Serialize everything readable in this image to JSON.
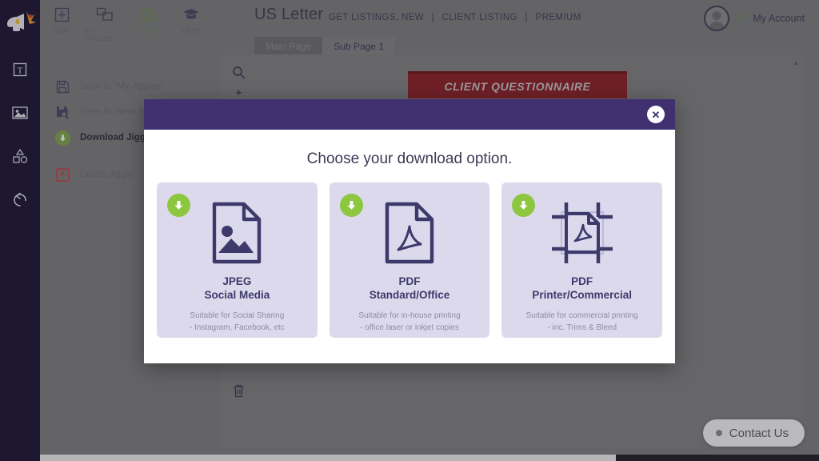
{
  "rail": {
    "logo_icon": "megaphone-burst-logo",
    "items": [
      {
        "icon": "text-tool-icon",
        "name": "text-tool"
      },
      {
        "icon": "image-tool-icon",
        "name": "image-tool"
      },
      {
        "icon": "shapes-tool-icon",
        "name": "shapes-tool"
      },
      {
        "icon": "undo-tool-icon",
        "name": "undo-tool"
      }
    ]
  },
  "toolbar": {
    "items": [
      {
        "label": "NEW",
        "icon": "plus-square-icon"
      },
      {
        "label": "MY JIGGLES",
        "icon": "frames-icon"
      },
      {
        "label": "SAVE",
        "icon": "floppy-disk-icon"
      },
      {
        "label": "HELP",
        "icon": "graduation-cap-icon"
      }
    ]
  },
  "header": {
    "doc_title": "US Letter",
    "breadcrumbs": [
      "GET LISTINGS, NEW",
      "CLIENT LISTING",
      "PREMIUM"
    ],
    "separator": "|",
    "tabs": [
      {
        "label": "Main Page",
        "state": "dim"
      },
      {
        "label": "Sub Page 1",
        "state": "active"
      }
    ],
    "account_label": "My Account",
    "account_icon": "gear-icon",
    "avatar_icon": "user-avatar"
  },
  "left_menu": {
    "items": [
      {
        "label": "Save to \"My Jiggles\"",
        "icon": "floppy-disk-icon",
        "emphasis": "normal"
      },
      {
        "label": "Save As New Jiggle",
        "icon": "floppy-disk-copy-icon",
        "emphasis": "normal"
      },
      {
        "label": "Download Jiggle",
        "icon": "download-circle-icon",
        "emphasis": "strong"
      },
      {
        "label": "Delete Jiggle",
        "icon": "delete-x-icon",
        "emphasis": "normal"
      }
    ]
  },
  "canvas": {
    "tools": [
      {
        "icon": "magnifier-icon",
        "name": "zoom-tool"
      },
      {
        "icon": "plus-icon",
        "name": "zoom-in"
      }
    ],
    "bottom_tools": [
      {
        "icon": "layers-icon",
        "name": "layers-tool"
      },
      {
        "icon": "trash-icon",
        "name": "delete-element"
      }
    ],
    "banner_text": "CLIENT QUESTIONNAIRE",
    "banner_color": "#8e1d25"
  },
  "modal": {
    "title": "Choose your download option.",
    "close_label": "✕",
    "header_color": "#413070",
    "card_color": "#dcd9ec",
    "accent_green": "#8dc63f",
    "options": [
      {
        "icon": "jpeg-image-file-icon",
        "title_line1": "JPEG",
        "title_line2": "Social Media",
        "desc_line1": "Suitable for Social Sharing",
        "desc_line2": "- Instagram, Facebook, etc",
        "download_icon": "download-arrow-icon"
      },
      {
        "icon": "pdf-file-icon",
        "title_line1": "PDF",
        "title_line2": "Standard/Office",
        "desc_line1": "Suitable for in-house printing",
        "desc_line2": "- office laser or inkjet copies",
        "download_icon": "download-arrow-icon"
      },
      {
        "icon": "pdf-crop-marks-icon",
        "title_line1": "PDF",
        "title_line2": "Printer/Commercial",
        "desc_line1": "Suitable for commercial printing",
        "desc_line2": "- inc. Trims & Bleed",
        "download_icon": "download-arrow-icon"
      }
    ]
  },
  "contact": {
    "label": "Contact Us",
    "status_icon": "status-dot"
  }
}
